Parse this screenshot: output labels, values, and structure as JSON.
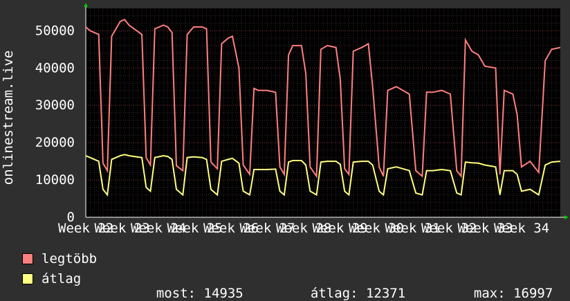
{
  "chart_data": {
    "type": "line",
    "ylabel": "onlinestream.live",
    "ylim": [
      0,
      56000
    ],
    "yticks": [
      0,
      10000,
      20000,
      30000,
      40000,
      50000
    ],
    "ytick_labels": [
      "0",
      "10000",
      "20000",
      "30000",
      "40000",
      "50000"
    ],
    "x_tick_labels": [
      "Week 22",
      "Week 23",
      "Week 24",
      "Week 25",
      "Week 26",
      "Week 27",
      "Week 28",
      "Week 29",
      "Week 30",
      "Week 31",
      "Week 32",
      "Week 33",
      "Week 34"
    ],
    "grid": true,
    "legend_placement": "bottom-left",
    "series": [
      {
        "name": "legtöbb",
        "color": "#ff7f7f",
        "values": [
          51000,
          50000,
          49000,
          14500,
          12500,
          48500,
          52500,
          53000,
          51500,
          49000,
          16000,
          14000,
          50500,
          51500,
          51000,
          49500,
          13800,
          12500,
          49000,
          51000,
          51000,
          50500,
          14800,
          13000,
          46500,
          48000,
          48500,
          40000,
          14000,
          11500,
          34500,
          34000,
          34000,
          33500,
          13500,
          11500,
          43500,
          46000,
          46000,
          38500,
          13500,
          11000,
          45000,
          46000,
          45500,
          37000,
          13000,
          11500,
          44500,
          45500,
          46500,
          35000,
          13500,
          11000,
          34000,
          35000,
          34000,
          33000,
          12500,
          11000,
          33500,
          33500,
          34000,
          33000,
          12500,
          11000,
          47500,
          44500,
          43500,
          40500,
          40000,
          11500,
          34000,
          33000,
          27500,
          13500,
          15000,
          12000,
          42000,
          45000,
          45500
        ],
        "x": [
          0,
          0.2,
          0.6,
          0.8,
          1,
          1.2,
          1.6,
          1.8,
          2,
          2.6,
          2.8,
          3,
          3.2,
          3.6,
          3.8,
          4,
          4.2,
          4.5,
          4.7,
          5,
          5.4,
          5.6,
          5.8,
          6.1,
          6.3,
          6.6,
          6.8,
          7.1,
          7.3,
          7.6,
          7.8,
          8,
          8.4,
          8.8,
          9,
          9.2,
          9.4,
          9.6,
          10,
          10.2,
          10.4,
          10.7,
          10.9,
          11.2,
          11.6,
          11.8,
          12,
          12.2,
          12.4,
          12.8,
          13.1,
          13.3,
          13.6,
          13.8,
          14,
          14.4,
          14.7,
          15,
          15.3,
          15.6,
          15.8,
          16.1,
          16.5,
          16.9,
          17.2,
          17.4,
          17.6,
          17.9,
          18.2,
          18.5,
          19,
          19.2,
          19.4,
          19.8,
          20,
          20.2,
          20.6,
          21,
          21.3,
          21.6,
          22
        ]
      },
      {
        "name": "átlag",
        "color": "#ffff80",
        "values": [
          16500,
          16000,
          15000,
          7500,
          6000,
          15500,
          16500,
          16800,
          16500,
          16000,
          8000,
          7000,
          16000,
          16500,
          16300,
          15500,
          7500,
          6000,
          16000,
          16200,
          16000,
          15500,
          7500,
          6000,
          15000,
          15500,
          15800,
          14500,
          7000,
          6000,
          12800,
          12800,
          12800,
          12900,
          7000,
          6000,
          14800,
          15200,
          15200,
          14000,
          7000,
          6000,
          14800,
          15000,
          15000,
          14200,
          7000,
          6000,
          14800,
          15000,
          15000,
          14000,
          7000,
          6000,
          13000,
          13500,
          13000,
          12500,
          6500,
          6000,
          12500,
          12500,
          12800,
          12500,
          6500,
          6000,
          14800,
          14600,
          14500,
          14000,
          13500,
          6000,
          12500,
          12500,
          11500,
          7000,
          7500,
          6000,
          14000,
          14800,
          15000
        ]
      }
    ]
  },
  "legend": [
    {
      "label": "legtöbb",
      "color": "#ff7f7f"
    },
    {
      "label": "átlag",
      "color": "#ffff80"
    }
  ],
  "stats": {
    "now_label": "most:",
    "now_value": "14935",
    "avg_label": "átlag:",
    "avg_value": "12371",
    "max_label": "max:",
    "max_value": "16997"
  }
}
